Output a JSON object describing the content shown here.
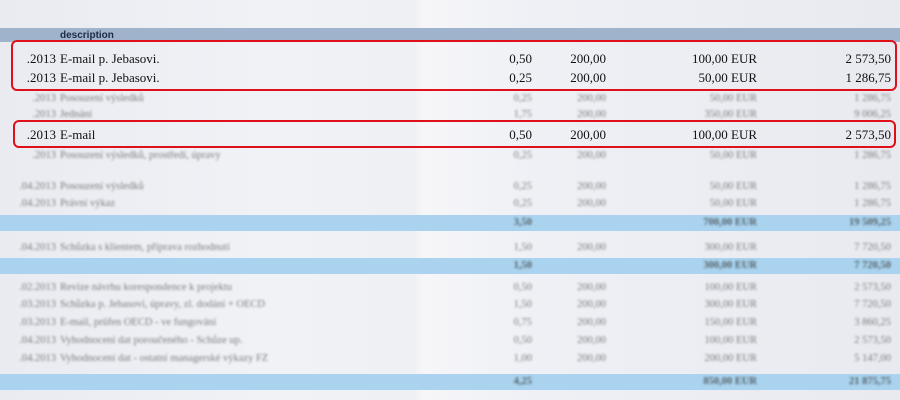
{
  "header": {
    "description": "description"
  },
  "highlighted_rows": [
    {
      "date": ".2013",
      "desc": "E-mail p. Jebasovi.",
      "hours": "0,50",
      "rate": "200,00",
      "price": "100,00 EUR",
      "total": "2 573,50"
    },
    {
      "date": ".2013",
      "desc": "E-mail p. Jebasovi.",
      "hours": "0,25",
      "rate": "200,00",
      "price": "50,00 EUR",
      "total": "1 286,75"
    },
    {
      "date": ".2013",
      "desc": "E-mail",
      "hours": "0,50",
      "rate": "200,00",
      "price": "100,00 EUR",
      "total": "2 573,50"
    }
  ],
  "faded_rows": [
    {
      "date": ".2013",
      "desc": "Posouzení výsledků",
      "hours": "0,25",
      "rate": "200,00",
      "price": "50,00 EUR",
      "total": "1 286,75"
    },
    {
      "date": ".2013",
      "desc": "Jednání",
      "hours": "1,75",
      "rate": "200,00",
      "price": "350,00 EUR",
      "total": "9 006,25"
    },
    {
      "date": ".2013",
      "desc": "Posouzení výsledků, prostředí, úpravy",
      "hours": "0,25",
      "rate": "200,00",
      "price": "50,00 EUR",
      "total": "1 286,75"
    },
    {
      "date": ".04.2013",
      "desc": "Posouzení výsledků",
      "hours": "0,25",
      "rate": "200,00",
      "price": "50,00 EUR",
      "total": "1 286,75"
    },
    {
      "date": ".04.2013",
      "desc": "Právní výkaz",
      "hours": "0,25",
      "rate": "200,00",
      "price": "50,00 EUR",
      "total": "1 286,75"
    }
  ],
  "sum_rows": [
    {
      "hours": "3,50",
      "price": "700,00 EUR",
      "total": "19 509,25"
    },
    {
      "hours": "1,50",
      "price": "300,00 EUR",
      "total": "7 720,50"
    },
    {
      "hours": "4,25",
      "price": "850,00 EUR",
      "total": "21 875,75"
    }
  ],
  "mid_rows": [
    {
      "date": ".04.2013",
      "desc": "Schůzka s klientem, příprava rozhodnutí",
      "hours": "1,50",
      "rate": "200,00",
      "price": "300,00 EUR",
      "total": "7 720,50"
    }
  ],
  "lower_rows": [
    {
      "date": ".02.2013",
      "desc": "Revize návrhu korespondence k projektu",
      "hours": "0,50",
      "rate": "200,00",
      "price": "100,00 EUR",
      "total": "2 573,50"
    },
    {
      "date": ".03.2013",
      "desc": "Schůzka p. Jebasovi, úpravy, zl. dodání + OECD",
      "hours": "1,50",
      "rate": "200,00",
      "price": "300,00 EUR",
      "total": "7 720,50"
    },
    {
      "date": ".03.2013",
      "desc": "E-mail, prüfen OECD - ve fungování",
      "hours": "0,75",
      "rate": "200,00",
      "price": "150,00 EUR",
      "total": "3 860,25"
    },
    {
      "date": ".04.2013",
      "desc": "Vyhodnocení dat poroučeného - Schůze up.",
      "hours": "0,50",
      "rate": "200,00",
      "price": "100,00 EUR",
      "total": "2 573,50"
    },
    {
      "date": ".04.2013",
      "desc": "Vyhodnocení dat - ostatní managerské výkazy FZ",
      "hours": "1,00",
      "rate": "200,00",
      "price": "200,00 EUR",
      "total": "5 147,00"
    }
  ]
}
